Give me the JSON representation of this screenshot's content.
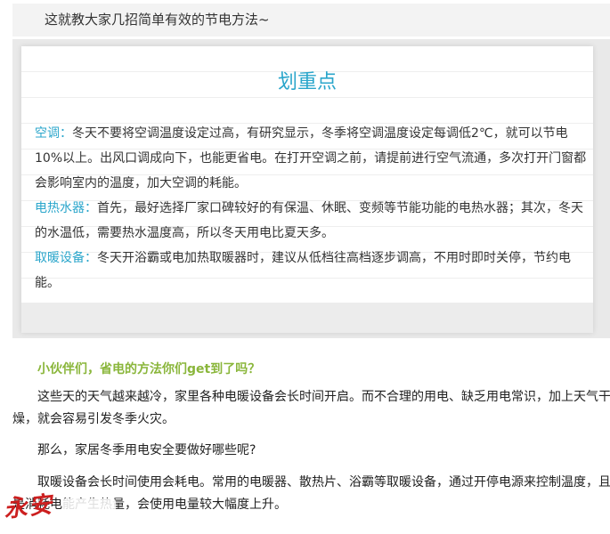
{
  "intro": "这就教大家几招简单有效的节电方法~",
  "card": {
    "title": "划重点",
    "items": [
      {
        "label": "空调：",
        "text": "冬天不要将空调温度设定过高，有研究显示，冬季将空调温度设定每调低2℃，就可以节电10%以上。出风口调成向下，也能更省电。在打开空调之前，请提前进行空气流通，多次打开门窗都会影响室内的温度，加大空调的耗能。"
      },
      {
        "label": "电热水器：",
        "text": "首先，最好选择厂家口碑较好的有保温、休眠、变频等节能功能的电热水器；其次，冬天的水温低，需要热水温度高，所以冬天用电比夏天多。"
      },
      {
        "label": "取暖设备：",
        "text": "冬天开浴霸或电加热取暖器时，建议从低档往高档逐步调高，不用时即时关停，节约电能。"
      }
    ]
  },
  "section_title": "小伙伴们，省电的方法你们get到了吗？",
  "paragraphs": [
    "这些天的天气越来越冷，家里各种电暖设备会长时间开启。而不合理的用电、缺乏用电常识，加上天气干燥，就会容易引发冬季火灾。",
    "那么，家居冬季用电安全要做好哪些呢?",
    "取暖设备会长时间使用会耗电。常用的电暖器、散热片、浴霸等取暖设备，通过开停电源来控制温度，且是消耗电能产生热量，会使用电量较大幅度上升。"
  ],
  "watermark": "永安"
}
